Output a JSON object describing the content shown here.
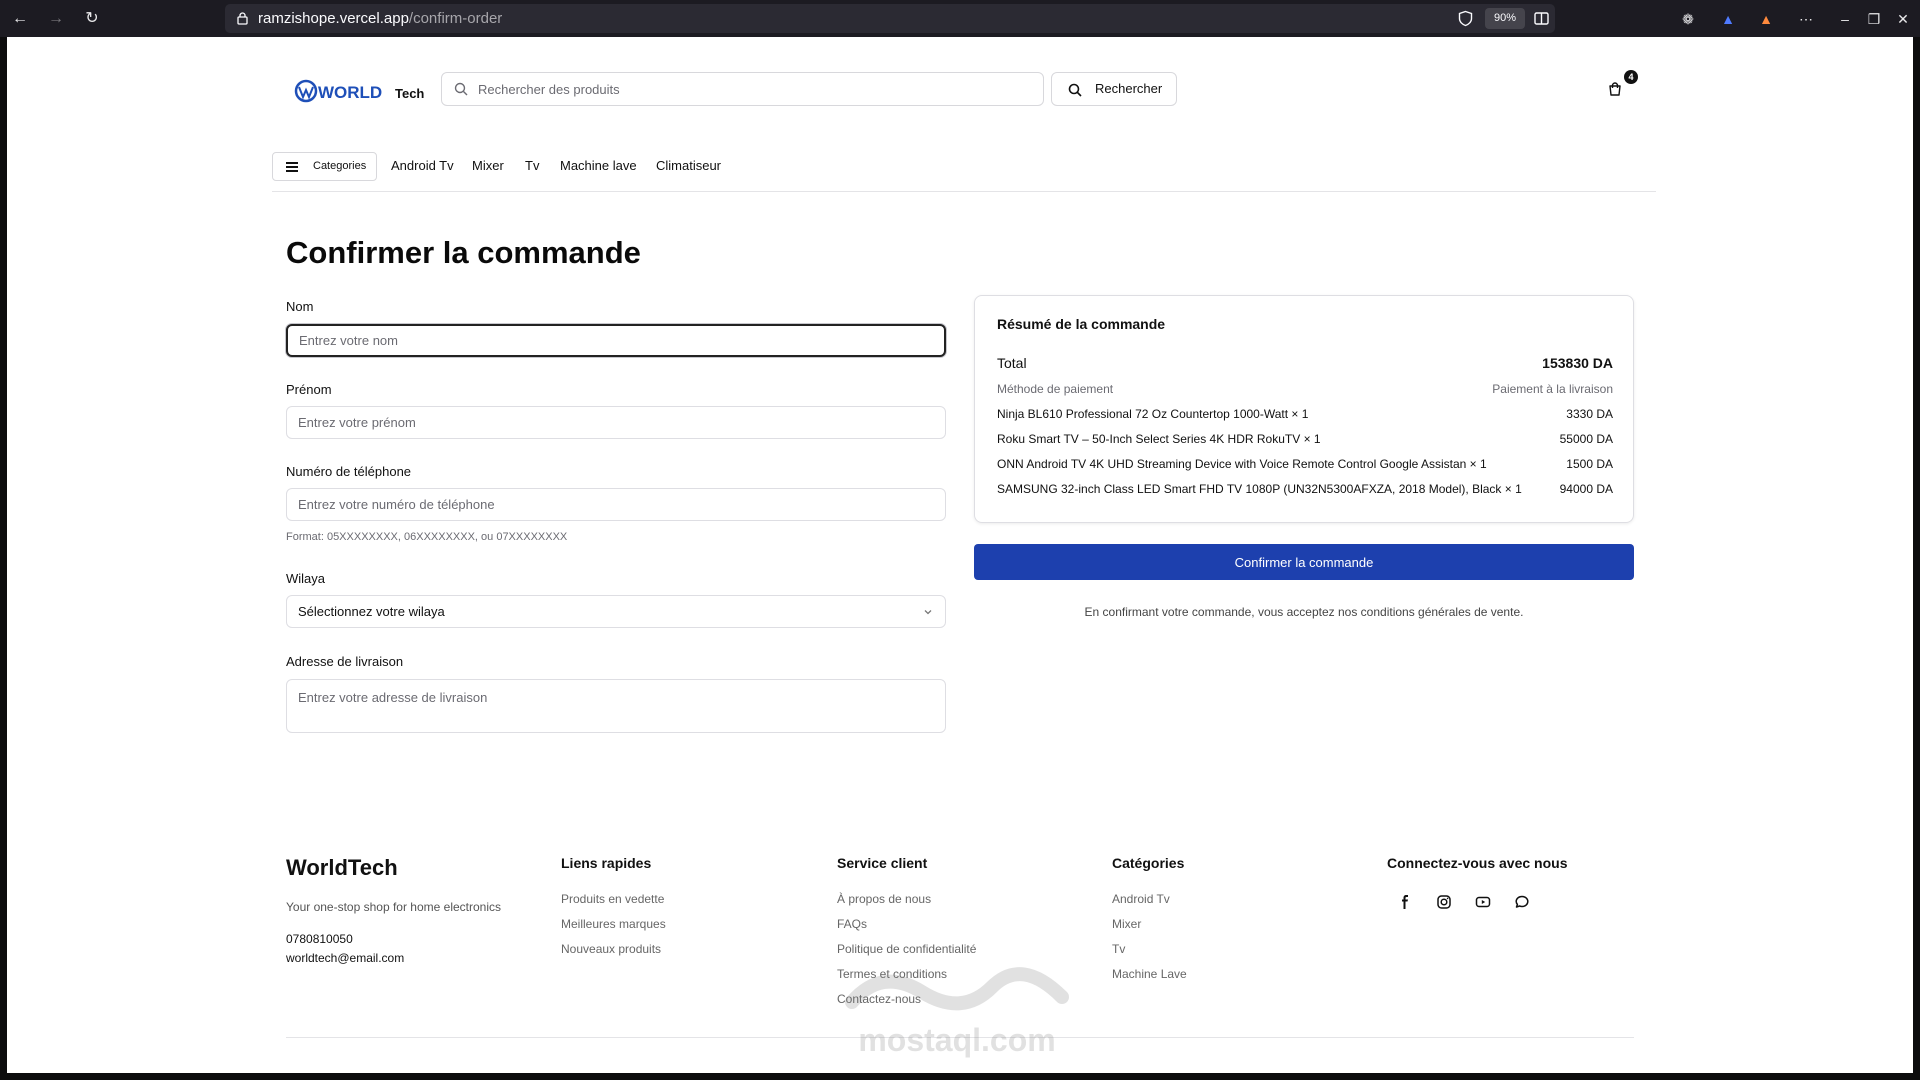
{
  "browser": {
    "url_domain": "ramzishope.vercel.app",
    "url_path": "/confirm-order",
    "zoom": "90%"
  },
  "header": {
    "logo_main": "WORLD",
    "logo_sub": "Tech",
    "search_placeholder": "Rechercher des produits",
    "search_button": "Rechercher",
    "cart_count": "4"
  },
  "nav": {
    "categories_button": "Categories",
    "links": [
      "Android Tv",
      "Mixer",
      "Tv",
      "Machine lave",
      "Climatiseur"
    ]
  },
  "page": {
    "title": "Confirmer la commande"
  },
  "form": {
    "nom_label": "Nom",
    "nom_placeholder": "Entrez votre nom",
    "prenom_label": "Prénom",
    "prenom_placeholder": "Entrez votre prénom",
    "phone_label": "Numéro de téléphone",
    "phone_placeholder": "Entrez votre numéro de téléphone",
    "phone_hint": "Format: 05XXXXXXXX, 06XXXXXXXX, ou 07XXXXXXXX",
    "wilaya_label": "Wilaya",
    "wilaya_value": "Sélectionnez votre wilaya",
    "address_label": "Adresse de livraison",
    "address_placeholder": "Entrez votre adresse de livraison"
  },
  "summary": {
    "title": "Résumé de la commande",
    "total_label": "Total",
    "total_value": "153830 DA",
    "payment_label": "Méthode de paiement",
    "payment_value": "Paiement à la livraison",
    "items": [
      {
        "name": "Ninja BL610 Professional 72 Oz Countertop 1000-Watt × 1",
        "price": "3330 DA"
      },
      {
        "name": "Roku Smart TV – 50-Inch Select Series 4K HDR RokuTV × 1",
        "price": "55000 DA"
      },
      {
        "name": "ONN Android TV 4K UHD Streaming Device with Voice Remote Control Google Assistan × 1",
        "price": "1500 DA"
      },
      {
        "name": "SAMSUNG 32-inch Class LED Smart FHD TV 1080P (UN32N5300AFXZA, 2018 Model), Black × 1",
        "price": "94000 DA"
      }
    ],
    "confirm_button": "Confirmer la commande",
    "terms": "En confirmant votre commande, vous acceptez nos conditions générales de vente."
  },
  "footer": {
    "brand": "WorldTech",
    "tagline": "Your one-stop shop for home electronics",
    "phone": "0780810050",
    "email": "worldtech@email.com",
    "quick_links_title": "Liens rapides",
    "quick_links": [
      "Produits en vedette",
      "Meilleures marques",
      "Nouveaux produits"
    ],
    "service_title": "Service client",
    "service_links": [
      "À propos de nous",
      "FAQs",
      "Politique de confidentialité",
      "Termes et conditions",
      "Contactez-nous"
    ],
    "categories_title": "Catégories",
    "categories": [
      "Android Tv",
      "Mixer",
      "Tv",
      "Machine Lave"
    ],
    "social_title": "Connectez-vous avec nous",
    "social_icons": [
      "facebook-icon",
      "instagram-icon",
      "youtube-icon",
      "chat-icon"
    ]
  },
  "watermark": {
    "text": "mostaql.com"
  },
  "colors": {
    "primary_button": "#1d40ae",
    "logo_blue": "#1e4fb8"
  }
}
